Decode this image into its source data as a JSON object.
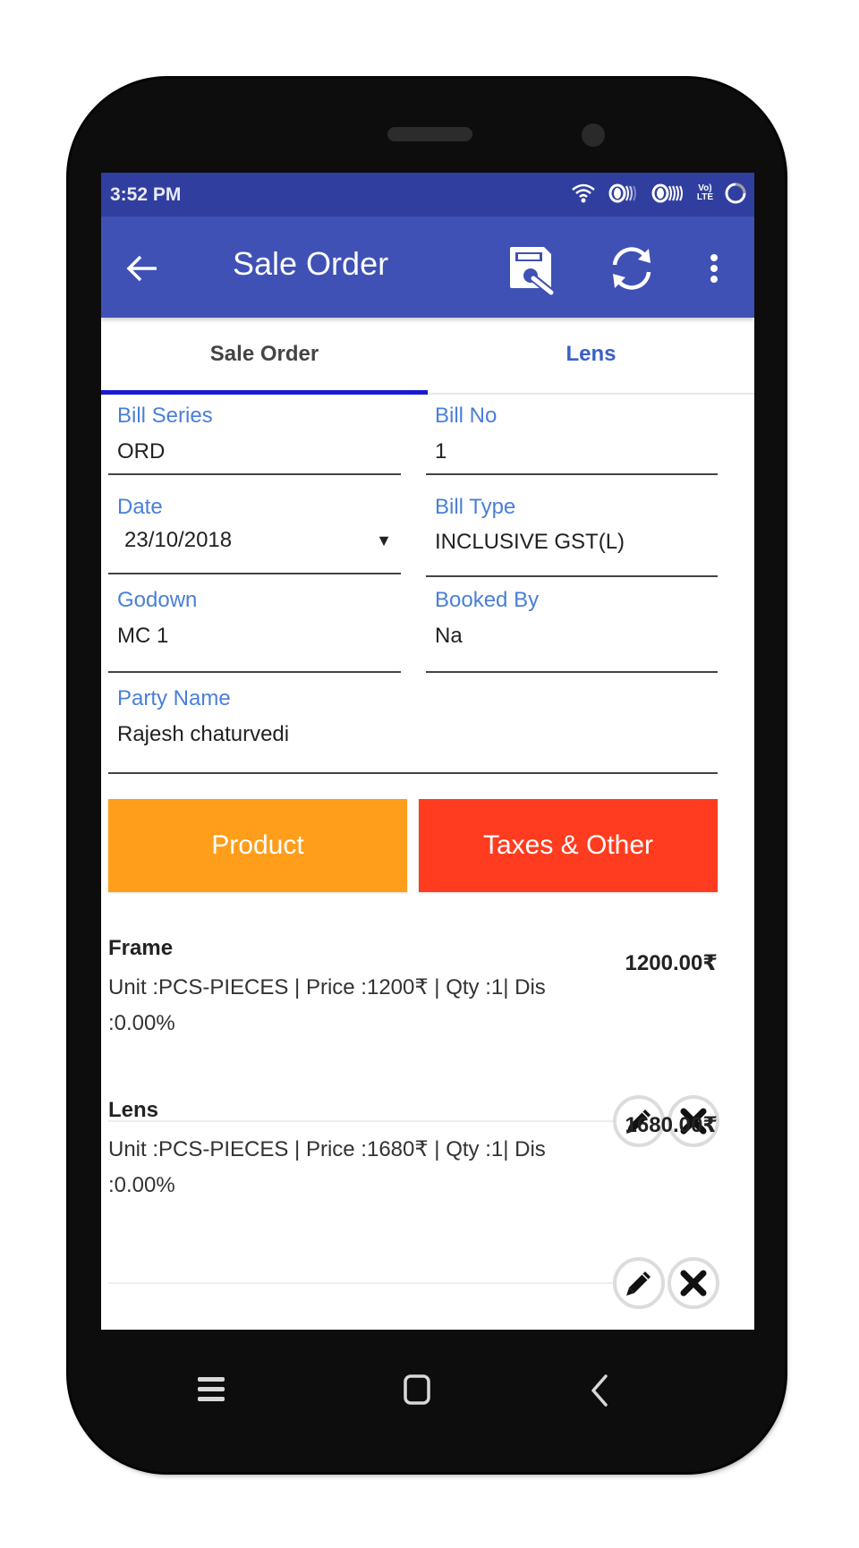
{
  "status_bar": {
    "time": "3:52 PM",
    "icons": [
      "wifi-icon",
      "signal-1-icon",
      "signal-2-icon",
      "volte-icon",
      "battery-icon"
    ],
    "volte_text_top": "Vo)",
    "volte_text_bottom": "LTE"
  },
  "app_bar": {
    "title": "Sale Order",
    "back_icon": "arrow-left-icon",
    "actions": [
      "save-icon",
      "refresh-icon",
      "more-vert-icon"
    ]
  },
  "tabs": [
    {
      "label": "Sale Order",
      "active": true
    },
    {
      "label": "Lens",
      "active": false
    }
  ],
  "form": {
    "bill_series": {
      "label": "Bill Series",
      "value": "ORD"
    },
    "bill_no": {
      "label": "Bill No",
      "value": "1"
    },
    "date": {
      "label": "Date",
      "value": "23/10/2018",
      "arrow": "▼"
    },
    "bill_type": {
      "label": "Bill Type",
      "value": "INCLUSIVE GST(L)"
    },
    "godown": {
      "label": "Godown",
      "value": "MC 1"
    },
    "booked_by": {
      "label": "Booked By",
      "value": "Na"
    },
    "party_name": {
      "label": "Party Name",
      "value": "Rajesh chaturvedi"
    }
  },
  "buttons": {
    "product": "Product",
    "taxes": "Taxes & Other"
  },
  "colors": {
    "primary": "#3f51b5",
    "status_bar": "#303f9f",
    "label_blue": "#4a7fd8",
    "product_orange": "#ff9e1b",
    "taxes_red": "#ff3c1f",
    "tab_indicator": "#1a1ad6"
  },
  "items": [
    {
      "name": "Frame",
      "detail": "Unit :PCS-PIECES | Price :1200₹ | Qty :1| Dis :0.00%",
      "amount": "1200.00₹"
    },
    {
      "name": "Lens",
      "detail": "Unit :PCS-PIECES | Price :1680₹ | Qty :1| Dis :0.00%",
      "amount": "1680.00₹"
    }
  ],
  "nav_bar": [
    "menu-icon",
    "home-icon",
    "back-icon"
  ]
}
